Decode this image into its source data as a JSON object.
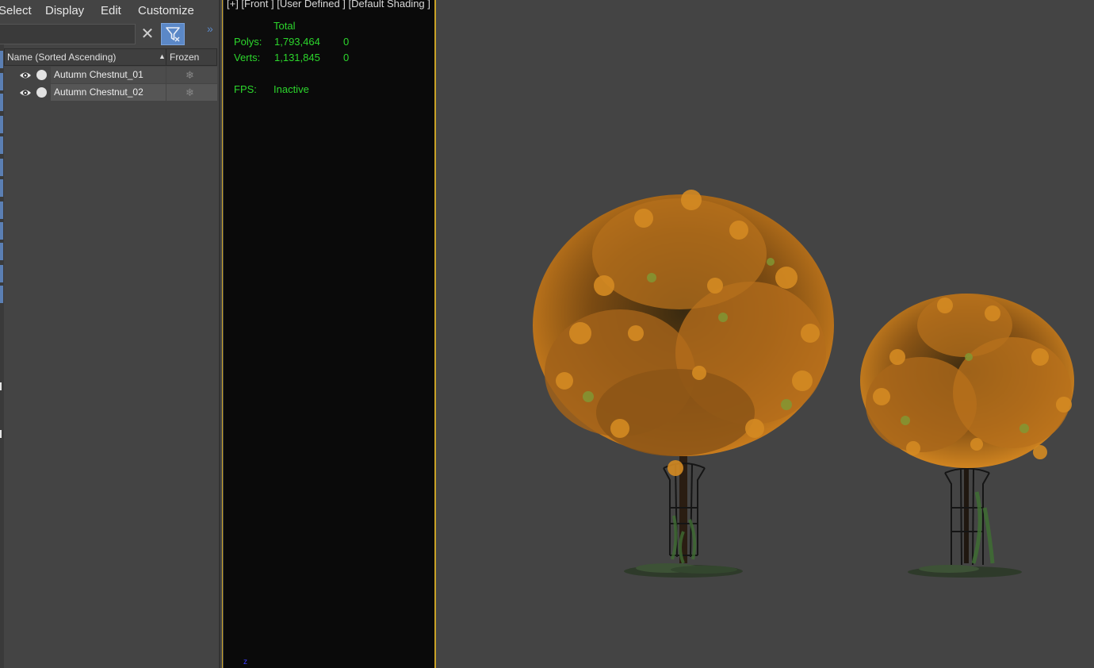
{
  "menu": {
    "select": "Select",
    "display": "Display",
    "edit": "Edit",
    "customize": "Customize"
  },
  "explorer": {
    "search_value": "",
    "expand_icon": "»",
    "columns": {
      "name": "Name (Sorted Ascending)",
      "frozen": "Frozen"
    },
    "rows": [
      {
        "name": "Autumn Chestnut_01",
        "visible": true,
        "frozen": false,
        "selected": false
      },
      {
        "name": "Autumn Chestnut_02",
        "visible": true,
        "frozen": false,
        "selected": true
      }
    ]
  },
  "viewport": {
    "label": "[+] [Front ] [User Defined ] [Default Shading ]",
    "stats": {
      "header": "Total",
      "polys_label": "Polys:",
      "polys_total": "1,793,464",
      "polys_sel": "0",
      "verts_label": "Verts:",
      "verts_total": "1,131,845",
      "verts_sel": "0",
      "fps_label": "FPS:",
      "fps_value": "Inactive"
    },
    "axis_label": "z"
  },
  "colors": {
    "accent": "#5b88c7",
    "viewport_frame": "#c9a227",
    "stats_text": "#2cd62c",
    "foliage": "#c9781c"
  },
  "icons": [
    "close-icon",
    "filter-icon",
    "eye-icon",
    "snowflake-icon"
  ]
}
